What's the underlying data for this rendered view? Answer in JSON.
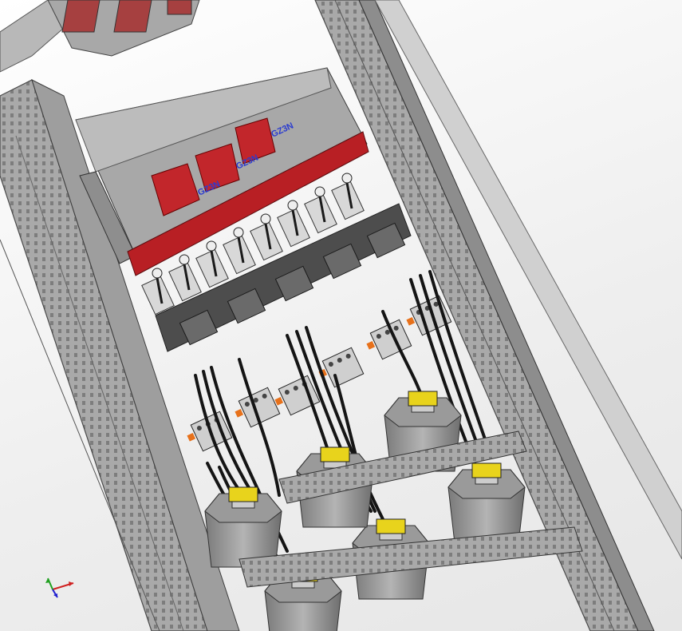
{
  "viewport": {
    "background": "#f2f2f2",
    "description_colors": {
      "frame": "#8a8a8a",
      "panel": "#b9b9b9",
      "busbar": "#b81f24",
      "cable": "#1a1a1a",
      "terminal": "#e8d31c",
      "contactor_accent": "#e7711b",
      "label_text": "#2a3bd0"
    }
  },
  "model": {
    "part_labels": [
      "GZ3N",
      "GZ3N",
      "GZ3N"
    ],
    "fuse_count": 8,
    "contactor_count": 6,
    "capacitor_count": 6
  },
  "triad": {
    "axes": [
      {
        "name": "x",
        "color": "#d02020"
      },
      {
        "name": "y",
        "color": "#20a020"
      },
      {
        "name": "z",
        "color": "#2020d0"
      }
    ]
  }
}
